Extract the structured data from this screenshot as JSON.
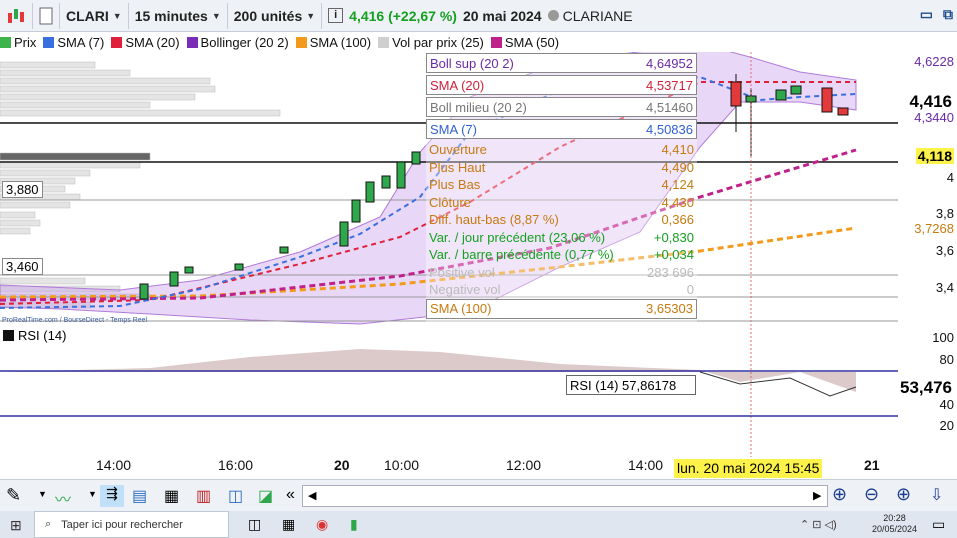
{
  "toolbar": {
    "ticker": "CLARI",
    "timeframe": "15 minutes",
    "units": "200 unités",
    "price_change": "4,416 (+22,67 %)",
    "date": "20 mai 2024",
    "company": "CLARIANE"
  },
  "legend": [
    "Prix",
    "SMA (7)",
    "SMA (20)",
    "Bollinger (20 2)",
    "SMA (100)",
    "Vol par prix (25)",
    "SMA (50)"
  ],
  "info": [
    {
      "label": "Boll sup (20 2)",
      "value": "4,64952"
    },
    {
      "label": "SMA (20)",
      "value": "4,53717"
    },
    {
      "label": "Boll milieu (20 2)",
      "value": "4,51460"
    },
    {
      "label": "SMA (7)",
      "value": "4,50836"
    },
    {
      "label": "Ouverture",
      "value": "4,410"
    },
    {
      "label": "Plus Haut",
      "value": "4,490"
    },
    {
      "label": "Plus Bas",
      "value": "4,124"
    },
    {
      "label": "Clôture",
      "value": "4,430"
    },
    {
      "label": "Diff. haut-bas (8,87 %)",
      "value": "0,366"
    },
    {
      "label": "Var. / jour précédent (23,06 %)",
      "value": "+0,830"
    },
    {
      "label": "Var. / barre précédente (0,77 %)",
      "value": "+0,034"
    },
    {
      "label": "Positive vol",
      "value": "283 696"
    },
    {
      "label": "Negative vol",
      "value": "0"
    },
    {
      "label": "SMA (100)",
      "value": "3,65303"
    }
  ],
  "levels": [
    "3,880",
    "3,460"
  ],
  "source": "ProRealTime.com / BourseDirect - Temps Reel",
  "axis": {
    "prices": [
      "4,6228",
      "4,416",
      "4,3440",
      "4,118",
      "4",
      "3,8",
      "3,7268",
      "3,6",
      "3,4"
    ]
  },
  "rsi": {
    "label": "RSI (14)",
    "crosshair": "RSI (14)  57,86178",
    "current": "53,476",
    "ticks": [
      "100",
      "80",
      "40",
      "20"
    ]
  },
  "time_axis": [
    "14:00",
    "16:00",
    "20",
    "10:00",
    "12:00",
    "14:00",
    "21"
  ],
  "crosshair_date": "lun. 20 mai 2024 15:45",
  "colors": {
    "up_candle": "#2ea84a",
    "down_candle": "#e23a3a",
    "sma7": "#3a6fe0",
    "sma20": "#e0203a",
    "bollinger": "#7a2eb8",
    "sma100": "#f29a1c",
    "sma50": "#c0208a",
    "crosshair_tag": "#fdf24a"
  },
  "taskbar": {
    "search_placeholder": "Taper ici pour rechercher",
    "time": "20:28",
    "date": "20/05/2024"
  }
}
